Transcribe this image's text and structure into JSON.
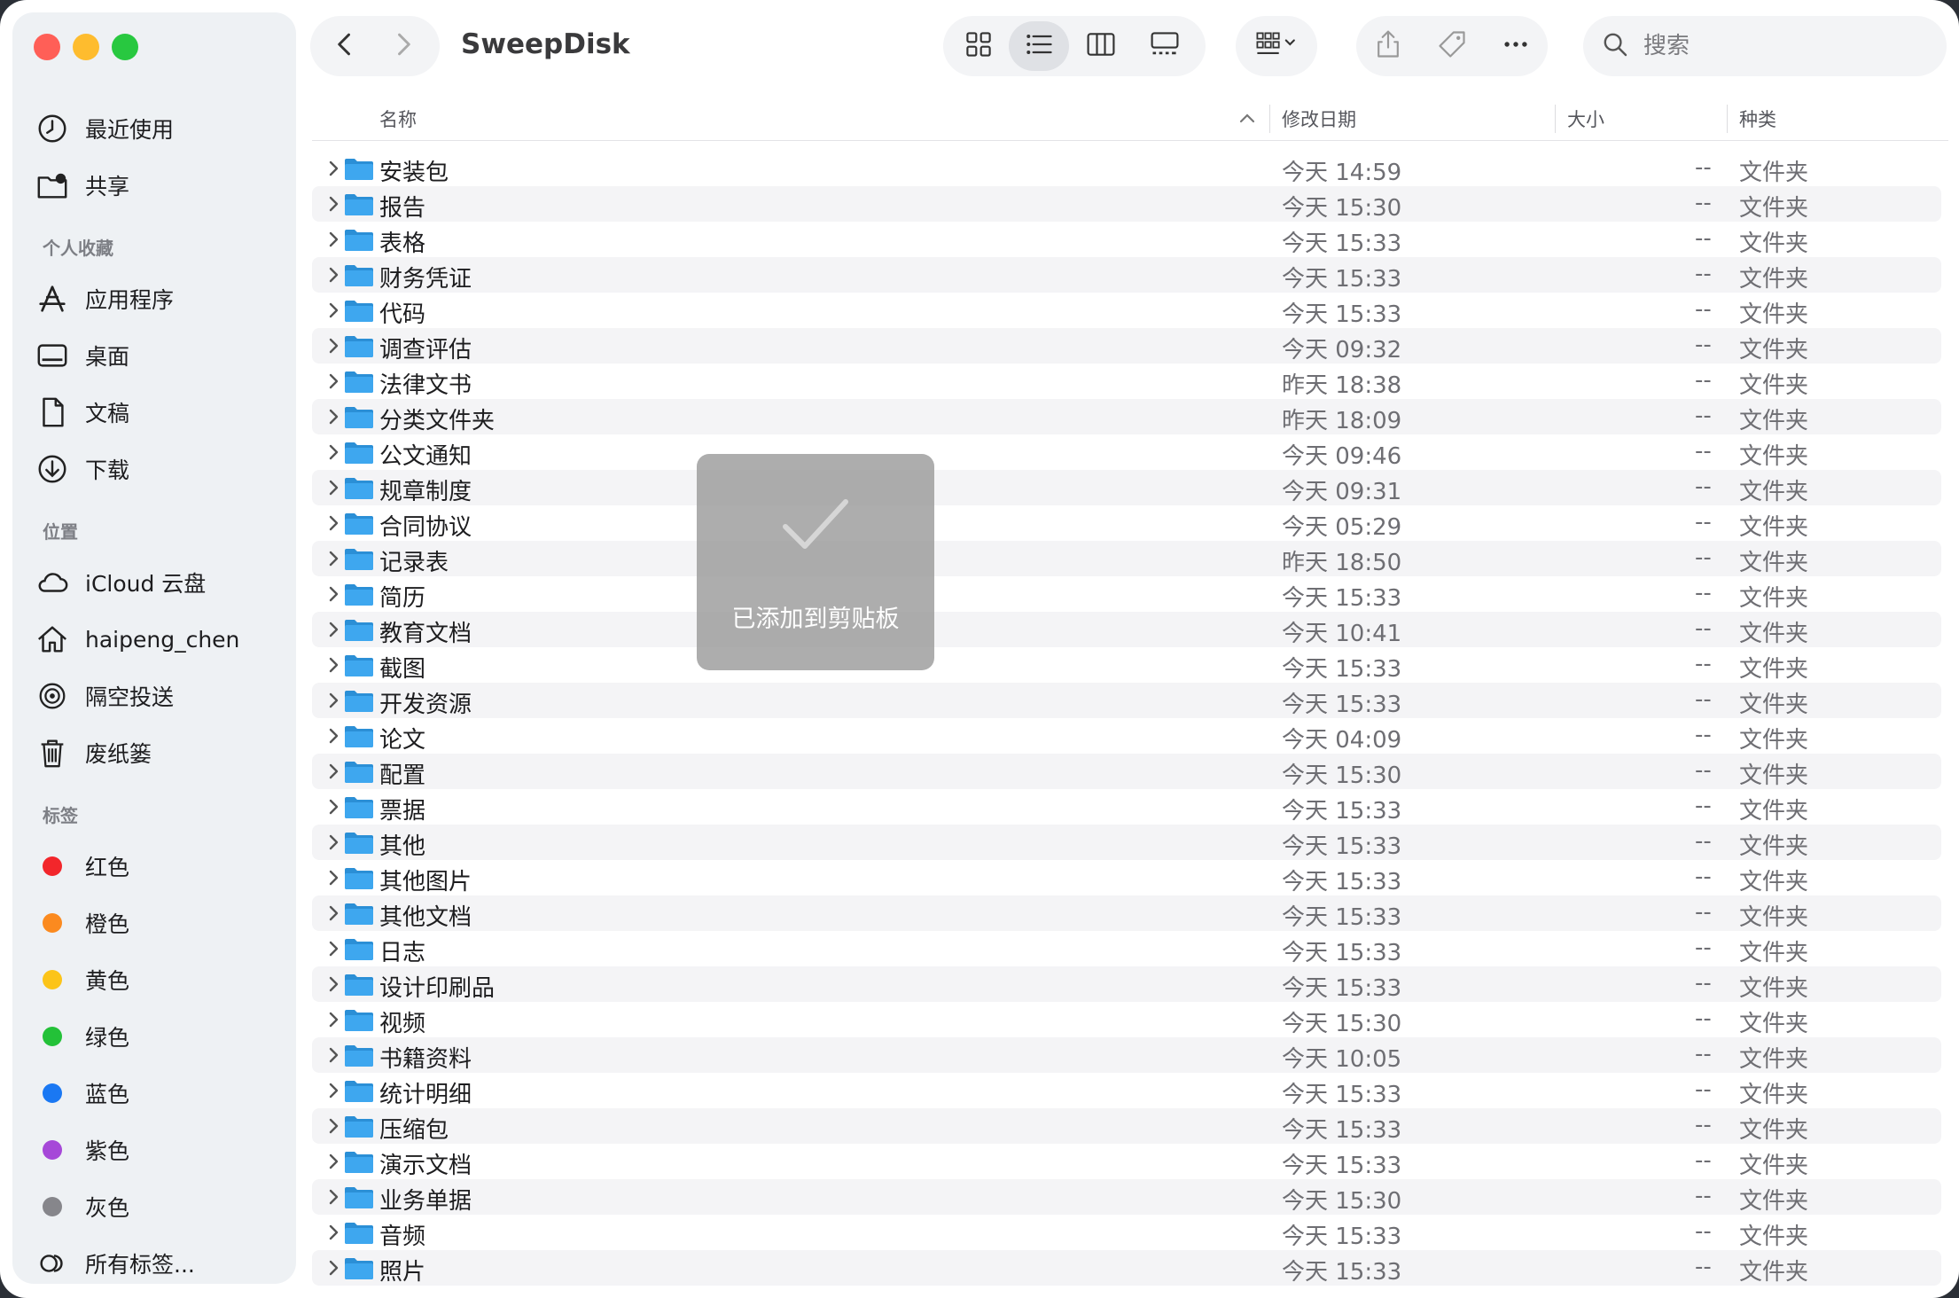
{
  "window": {
    "title": "SweepDisk"
  },
  "sidebar": {
    "items": [
      {
        "label": "最近使用",
        "icon": "clock-icon"
      },
      {
        "label": "共享",
        "icon": "shared-folder-icon"
      }
    ],
    "favorites_heading": "个人收藏",
    "favorites": [
      {
        "label": "应用程序",
        "icon": "applications-icon"
      },
      {
        "label": "桌面",
        "icon": "desktop-icon"
      },
      {
        "label": "文稿",
        "icon": "document-icon"
      },
      {
        "label": "下载",
        "icon": "download-icon"
      }
    ],
    "locations_heading": "位置",
    "locations": [
      {
        "label": "iCloud 云盘",
        "icon": "cloud-icon"
      },
      {
        "label": "haipeng_chen",
        "icon": "home-icon"
      },
      {
        "label": "隔空投送",
        "icon": "airdrop-icon"
      },
      {
        "label": "废纸篓",
        "icon": "trash-icon"
      }
    ],
    "tags_heading": "标签",
    "tags": [
      {
        "label": "红色",
        "color": "#f2262b"
      },
      {
        "label": "橙色",
        "color": "#fb8a1f"
      },
      {
        "label": "黄色",
        "color": "#fcc419"
      },
      {
        "label": "绿色",
        "color": "#23c138"
      },
      {
        "label": "蓝色",
        "color": "#1a78f3"
      },
      {
        "label": "紫色",
        "color": "#a648d8"
      },
      {
        "label": "灰色",
        "color": "#86868b"
      }
    ],
    "all_tags": "所有标签..."
  },
  "toolbar": {
    "search_placeholder": "搜索",
    "active_view": "list"
  },
  "columns": {
    "name": "名称",
    "date": "修改日期",
    "size": "大小",
    "kind": "种类"
  },
  "files": [
    {
      "name": "安装包",
      "date": "今天 14:59",
      "size": "--",
      "kind": "文件夹"
    },
    {
      "name": "报告",
      "date": "今天 15:30",
      "size": "--",
      "kind": "文件夹"
    },
    {
      "name": "表格",
      "date": "今天 15:33",
      "size": "--",
      "kind": "文件夹"
    },
    {
      "name": "财务凭证",
      "date": "今天 15:33",
      "size": "--",
      "kind": "文件夹"
    },
    {
      "name": "代码",
      "date": "今天 15:33",
      "size": "--",
      "kind": "文件夹"
    },
    {
      "name": "调查评估",
      "date": "今天 09:32",
      "size": "--",
      "kind": "文件夹"
    },
    {
      "name": "法律文书",
      "date": "昨天 18:38",
      "size": "--",
      "kind": "文件夹"
    },
    {
      "name": "分类文件夹",
      "date": "昨天 18:09",
      "size": "--",
      "kind": "文件夹"
    },
    {
      "name": "公文通知",
      "date": "今天 09:46",
      "size": "--",
      "kind": "文件夹"
    },
    {
      "name": "规章制度",
      "date": "今天 09:31",
      "size": "--",
      "kind": "文件夹"
    },
    {
      "name": "合同协议",
      "date": "今天 05:29",
      "size": "--",
      "kind": "文件夹"
    },
    {
      "name": "记录表",
      "date": "昨天 18:50",
      "size": "--",
      "kind": "文件夹"
    },
    {
      "name": "简历",
      "date": "今天 15:33",
      "size": "--",
      "kind": "文件夹"
    },
    {
      "name": "教育文档",
      "date": "今天 10:41",
      "size": "--",
      "kind": "文件夹"
    },
    {
      "name": "截图",
      "date": "今天 15:33",
      "size": "--",
      "kind": "文件夹"
    },
    {
      "name": "开发资源",
      "date": "今天 15:33",
      "size": "--",
      "kind": "文件夹"
    },
    {
      "name": "论文",
      "date": "今天 04:09",
      "size": "--",
      "kind": "文件夹"
    },
    {
      "name": "配置",
      "date": "今天 15:30",
      "size": "--",
      "kind": "文件夹"
    },
    {
      "name": "票据",
      "date": "今天 15:33",
      "size": "--",
      "kind": "文件夹"
    },
    {
      "name": "其他",
      "date": "今天 15:33",
      "size": "--",
      "kind": "文件夹"
    },
    {
      "name": "其他图片",
      "date": "今天 15:33",
      "size": "--",
      "kind": "文件夹"
    },
    {
      "name": "其他文档",
      "date": "今天 15:33",
      "size": "--",
      "kind": "文件夹"
    },
    {
      "name": "日志",
      "date": "今天 15:33",
      "size": "--",
      "kind": "文件夹"
    },
    {
      "name": "设计印刷品",
      "date": "今天 15:33",
      "size": "--",
      "kind": "文件夹"
    },
    {
      "name": "视频",
      "date": "今天 15:30",
      "size": "--",
      "kind": "文件夹"
    },
    {
      "name": "书籍资料",
      "date": "今天 10:05",
      "size": "--",
      "kind": "文件夹"
    },
    {
      "name": "统计明细",
      "date": "今天 15:33",
      "size": "--",
      "kind": "文件夹"
    },
    {
      "name": "压缩包",
      "date": "今天 15:33",
      "size": "--",
      "kind": "文件夹"
    },
    {
      "name": "演示文档",
      "date": "今天 15:33",
      "size": "--",
      "kind": "文件夹"
    },
    {
      "name": "业务单据",
      "date": "今天 15:30",
      "size": "--",
      "kind": "文件夹"
    },
    {
      "name": "音频",
      "date": "今天 15:33",
      "size": "--",
      "kind": "文件夹"
    },
    {
      "name": "照片",
      "date": "今天 15:33",
      "size": "--",
      "kind": "文件夹"
    }
  ],
  "toast": {
    "message": "已添加到剪贴板",
    "icon": "checkmark-icon"
  },
  "colors": {
    "folder": "#3ea7ef",
    "folder_tab": "#2b8fd6",
    "close": "#ff5f57",
    "minimize": "#febc2e",
    "zoom": "#28c840"
  }
}
